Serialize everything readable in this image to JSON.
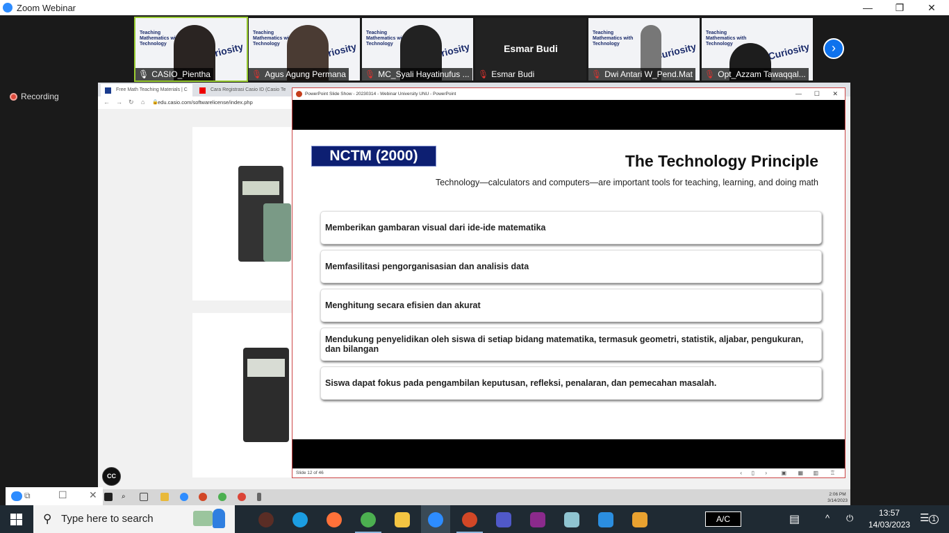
{
  "window": {
    "title": "Zoom Webinar",
    "controls": [
      "minimize",
      "restore",
      "close"
    ]
  },
  "participants": [
    {
      "name": "CASIO_Pientha",
      "muted": false,
      "active": true,
      "video": true
    },
    {
      "name": "Agus Agung Permana",
      "muted": true,
      "video": true
    },
    {
      "name": "MC_Syali Hayatinufus ...",
      "muted": true,
      "video": true
    },
    {
      "name": "Esmar Budi",
      "muted": true,
      "video": false
    },
    {
      "name": "Dwi Antari W_Pend.Mat",
      "muted": true,
      "video": true
    },
    {
      "name": "Opt_Azzam Tawaqqal...",
      "muted": true,
      "video": true
    }
  ],
  "tile_slide": {
    "title": "Teaching Mathematics with Technology",
    "word": "Curiosity"
  },
  "recording": "Recording",
  "browser": {
    "tabs": [
      "Free Math Teaching Materials | C",
      "Cara Registrasi Casio ID (Casio Te"
    ],
    "url": "edu.casio.com/softwarelicense/index.php"
  },
  "ppt": {
    "title": "PowerPoint Slide Show  -  20230314 - Webinar University UNU - PowerPoint",
    "status": "Slide 12 of 46",
    "slide": {
      "badge": "NCTM (2000)",
      "title": "The Technology Principle",
      "subtitle": "Technology—calculators and computers—are important tools for teaching, learning, and doing math",
      "items": [
        "Memberikan gambaran visual dari ide-ide matematika",
        "Memfasilitasi pengorganisasian dan analisis data",
        "Menghitung secara efisien dan akurat",
        "Mendukung penyelidikan oleh siswa di setiap bidang matematika, termasuk geometri, statistik, aljabar, pengukuran, dan bilangan",
        "Siswa dapat fokus pada pengambilan keputusan, refleksi, penalaran, dan pemecahan masalah."
      ]
    }
  },
  "remote_clock": {
    "time": "2:06 PM",
    "date": "3/14/2023"
  },
  "cc_label": "CC",
  "taskbar": {
    "search_placeholder": "Type here to search",
    "ac": "A/C",
    "time": "13:57",
    "date": "14/03/2023",
    "notifications": "1"
  },
  "colors": {
    "zoom_blue": "#2d8cff",
    "badge_navy": "#0d1f72",
    "taskbar": "#1f2a33"
  }
}
